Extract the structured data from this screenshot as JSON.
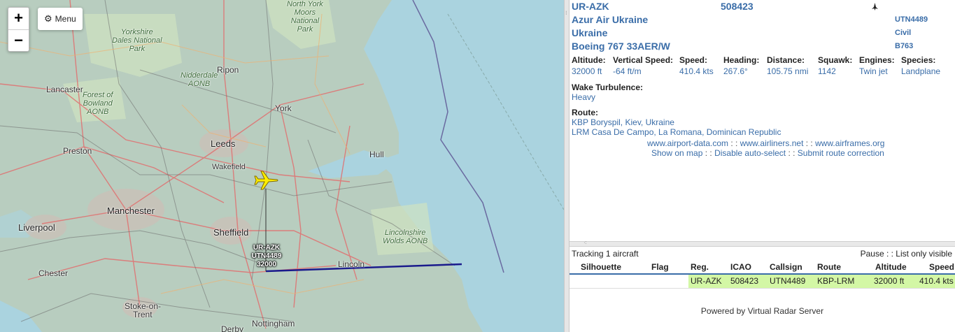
{
  "map": {
    "zoom_in": "+",
    "zoom_out": "−",
    "menu_label": "Menu",
    "menu_icon": "gear-icon",
    "places": {
      "lancaster": "Lancaster",
      "preston": "Preston",
      "manchester": "Manchester",
      "liverpool": "Liverpool",
      "chester": "Chester",
      "stoke_1": "Stoke-on-",
      "stoke_2": "Trent",
      "derby": "Derby",
      "nottingham": "Nottingham",
      "sheffield": "Sheffield",
      "wakefield": "Wakefield",
      "leeds": "Leeds",
      "york": "York",
      "ripon": "Ripon",
      "hull": "Hull",
      "lincoln": "Lincoln"
    },
    "parks": {
      "yorkshire_dales": [
        "Yorkshire",
        "Dales National",
        "Park"
      ],
      "north_york_moors": [
        "North York",
        "Moors",
        "National",
        "Park"
      ],
      "nidderdale": [
        "Nidderdale",
        "AONB"
      ],
      "bowland": [
        "Forest of",
        "Bowland",
        "AONB"
      ],
      "lincolnshire_wolds": [
        "Lincolnshire",
        "Wolds AONB"
      ]
    },
    "aircraft_label": {
      "reg": "UR-AZK",
      "callsign": "UTN4489",
      "altitude": "32000"
    }
  },
  "detail": {
    "registration": "UR-AZK",
    "icao": "508423",
    "operator": "Azur Air Ukraine",
    "callsign": "UTN4489",
    "country": "Ukraine",
    "category": "Civil",
    "model": "Boeing 767 33AER/W",
    "type_code": "B763",
    "facts": [
      {
        "key": "Altitude:",
        "value": "32000 ft"
      },
      {
        "key": "Vertical Speed:",
        "value": "-64 ft/m"
      },
      {
        "key": "Speed:",
        "value": "410.4 kts"
      },
      {
        "key": "Heading:",
        "value": "267.6°"
      },
      {
        "key": "Distance:",
        "value": "105.75 nmi"
      },
      {
        "key": "Squawk:",
        "value": "1142"
      },
      {
        "key": "Engines:",
        "value": "Twin jet"
      },
      {
        "key": "Species:",
        "value": "Landplane"
      }
    ],
    "wake_label": "Wake Turbulence:",
    "wake_value": "Heavy",
    "route_label": "Route:",
    "route_from": "KBP Boryspil, Kiev, Ukraine",
    "route_to": "LRM Casa De Campo, La Romana, Dominican Republic",
    "links_1": {
      "a": "www.airport-data.com",
      "b": "www.airliners.net",
      "c": "www.airframes.org",
      "sep": " : : "
    },
    "links_2": {
      "a": "Show on map",
      "b": "Disable auto-select",
      "c": "Submit route correction",
      "sep": " : : "
    }
  },
  "list": {
    "tracking": "Tracking 1 aircraft",
    "pause": "Pause",
    "list_only_visible": "List only visible",
    "sep": " : : ",
    "columns": [
      "Silhouette",
      "Flag",
      "Reg.",
      "ICAO",
      "Callsign",
      "Route",
      "Altitude",
      "Speed"
    ],
    "rows": [
      {
        "reg": "UR-AZK",
        "icao": "508423",
        "callsign": "UTN4489",
        "route": "KBP-LRM",
        "altitude": "32000 ft",
        "speed": "410.4 kts"
      }
    ],
    "powered_by": "Powered by Virtual Radar Server"
  },
  "colors": {
    "link_blue": "#3a6da8",
    "row_highlight": "#d3f7a5",
    "aircraft_yellow": "#ffee00",
    "track_line": "#1a1a8c"
  }
}
